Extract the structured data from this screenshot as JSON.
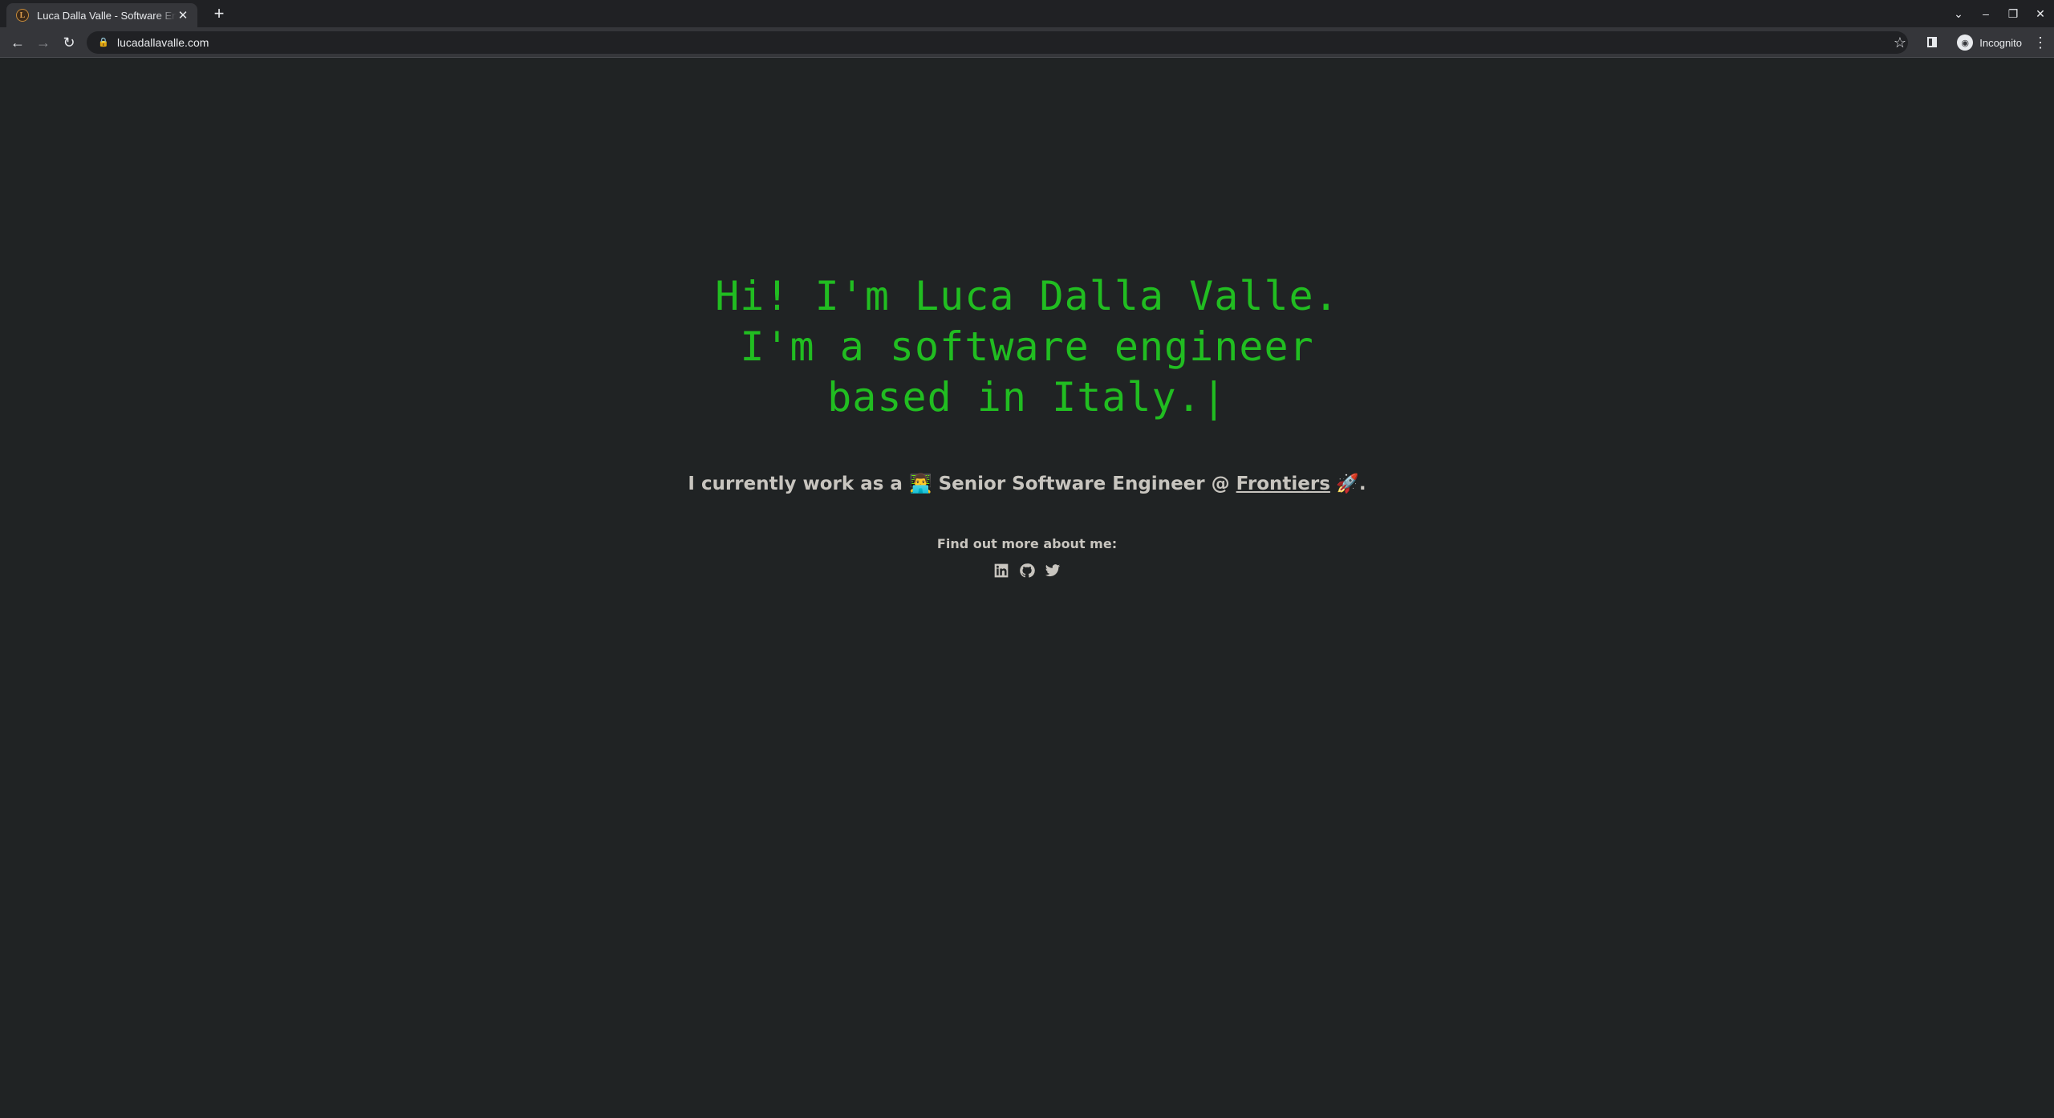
{
  "browser": {
    "tab_title": "Luca Dalla Valle - Software Engineer",
    "tab_close": "✕",
    "new_tab": "+",
    "url": "lucadallavalle.com",
    "profile_label": "Incognito",
    "window_controls": [
      "⌄",
      "–",
      "❐",
      "✕"
    ]
  },
  "page": {
    "hero_lines": [
      "Hi! I'm Luca Dalla Valle.",
      "I'm a software engineer",
      "based in Italy."
    ],
    "cursor": "|",
    "work_prefix": "I currently work as a ",
    "work_emoji": "👨‍💻",
    "work_role": " Senior Software Engineer @ ",
    "work_company": "Frontiers",
    "work_suffix_emoji": " 🚀",
    "work_end": ".",
    "find_out": "Find out more about me:",
    "socials": [
      "linkedin-icon",
      "github-icon",
      "twitter-icon"
    ]
  },
  "colors": {
    "background": "#202324",
    "hero_text": "#21bd21",
    "body_text": "#c8c5bf"
  }
}
